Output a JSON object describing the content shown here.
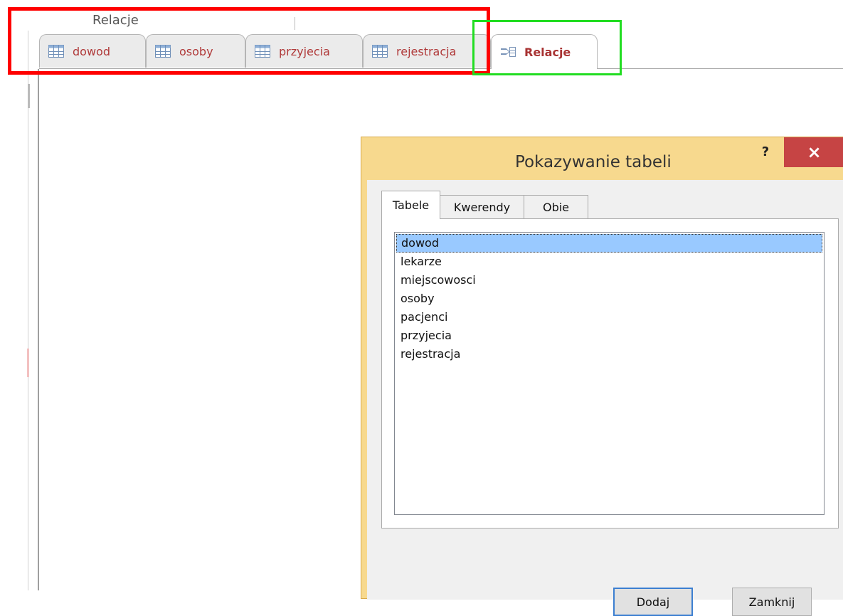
{
  "window": {
    "caption": "Relacje"
  },
  "tabs": [
    {
      "label": "dowod",
      "icon": "table-icon"
    },
    {
      "label": "osoby",
      "icon": "table-icon"
    },
    {
      "label": "przyjecia",
      "icon": "table-icon"
    },
    {
      "label": "rejestracja",
      "icon": "table-icon"
    },
    {
      "label": "Relacje",
      "icon": "relationships-icon",
      "active": true
    }
  ],
  "dialog": {
    "title": "Pokazywanie tabeli",
    "help": "?",
    "close": "×",
    "tabs": [
      "Tabele",
      "Kwerendy",
      "Obie"
    ],
    "active_tab": "Tabele",
    "items": [
      "dowod",
      "lekarze",
      "miejscowosci",
      "osoby",
      "pacjenci",
      "przyjecia",
      "rejestracja"
    ],
    "selected_item": "dowod",
    "buttons": {
      "add": "Dodaj",
      "close": "Zamknij"
    }
  },
  "annotations": {
    "red_box": "#ff0000",
    "green_box": "#22dd22"
  },
  "colors": {
    "tab_text": "#b03a3a",
    "dialog_frame": "#f7d98e",
    "close_button": "#c64444",
    "selection": "#99c9ff"
  }
}
